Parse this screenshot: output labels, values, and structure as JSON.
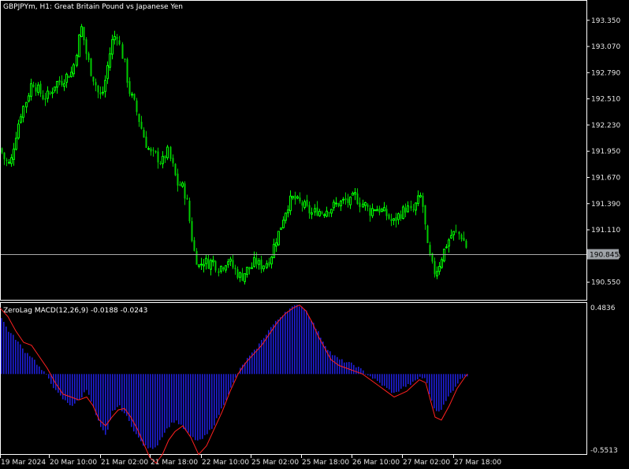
{
  "chart_data": [
    {
      "type": "candlestick",
      "title": "GBPJPYm, H1:  Great Britain Pound vs Japanese Yen",
      "current_price": "190.845",
      "ylim": [
        190.37,
        193.55
      ],
      "yticks": [
        "193.350",
        "193.070",
        "192.790",
        "192.510",
        "192.230",
        "191.950",
        "191.670",
        "191.390",
        "191.110",
        "190.830",
        "190.550"
      ],
      "xticks": [
        "19 Mar 2024",
        "20 Mar 10:00",
        "21 Mar 02:00",
        "21 Mar 18:00",
        "22 Mar 10:00",
        "25 Mar 02:00",
        "25 Mar 18:00",
        "26 Mar 10:00",
        "27 Mar 02:00",
        "27 Mar 18:00"
      ],
      "close_path": [
        [
          0,
          191.98
        ],
        [
          6,
          191.85
        ],
        [
          13,
          191.8
        ],
        [
          18,
          192.05
        ],
        [
          26,
          192.35
        ],
        [
          33,
          192.5
        ],
        [
          40,
          192.7
        ],
        [
          48,
          192.6
        ],
        [
          55,
          192.52
        ],
        [
          62,
          192.55
        ],
        [
          70,
          192.68
        ],
        [
          78,
          192.7
        ],
        [
          85,
          192.76
        ],
        [
          92,
          192.8
        ],
        [
          98,
          193.1
        ],
        [
          103,
          193.28
        ],
        [
          108,
          193.02
        ],
        [
          115,
          192.8
        ],
        [
          121,
          192.66
        ],
        [
          126,
          192.52
        ],
        [
          131,
          192.6
        ],
        [
          137,
          192.9
        ],
        [
          142,
          193.12
        ],
        [
          148,
          193.22
        ],
        [
          152,
          193.05
        ],
        [
          157,
          192.9
        ],
        [
          163,
          192.6
        ],
        [
          170,
          192.45
        ],
        [
          177,
          192.25
        ],
        [
          184,
          192.05
        ],
        [
          191,
          191.92
        ],
        [
          198,
          191.9
        ],
        [
          205,
          191.82
        ],
        [
          212,
          191.95
        ],
        [
          218,
          191.8
        ],
        [
          224,
          191.6
        ],
        [
          230,
          191.58
        ],
        [
          236,
          191.45
        ],
        [
          240,
          191.2
        ],
        [
          245,
          190.9
        ],
        [
          252,
          190.72
        ],
        [
          258,
          190.78
        ],
        [
          264,
          190.75
        ],
        [
          270,
          190.78
        ],
        [
          276,
          190.7
        ],
        [
          282,
          190.73
        ],
        [
          288,
          190.8
        ],
        [
          294,
          190.72
        ],
        [
          300,
          190.65
        ],
        [
          306,
          190.6
        ],
        [
          312,
          190.68
        ],
        [
          318,
          190.7
        ],
        [
          324,
          190.78
        ],
        [
          330,
          190.72
        ],
        [
          336,
          190.75
        ],
        [
          342,
          190.8
        ],
        [
          348,
          190.98
        ],
        [
          354,
          191.1
        ],
        [
          360,
          191.28
        ],
        [
          366,
          191.4
        ],
        [
          372,
          191.45
        ],
        [
          378,
          191.4
        ],
        [
          384,
          191.38
        ],
        [
          390,
          191.32
        ],
        [
          396,
          191.28
        ],
        [
          402,
          191.32
        ],
        [
          408,
          191.3
        ],
        [
          414,
          191.33
        ],
        [
          420,
          191.35
        ],
        [
          426,
          191.38
        ],
        [
          432,
          191.4
        ],
        [
          438,
          191.42
        ],
        [
          444,
          191.4
        ],
        [
          450,
          191.48
        ],
        [
          456,
          191.4
        ],
        [
          462,
          191.38
        ],
        [
          468,
          191.3
        ],
        [
          474,
          191.35
        ],
        [
          480,
          191.33
        ],
        [
          486,
          191.3
        ],
        [
          492,
          191.25
        ],
        [
          498,
          191.18
        ],
        [
          504,
          191.25
        ],
        [
          510,
          191.3
        ],
        [
          516,
          191.35
        ],
        [
          522,
          191.28
        ],
        [
          528,
          191.4
        ],
        [
          534,
          191.48
        ],
        [
          538,
          191.2
        ],
        [
          542,
          190.9
        ],
        [
          546,
          190.78
        ],
        [
          550,
          190.65
        ],
        [
          555,
          190.7
        ],
        [
          560,
          190.82
        ],
        [
          566,
          190.95
        ],
        [
          572,
          191.05
        ],
        [
          578,
          191.08
        ],
        [
          584,
          191.05
        ],
        [
          590,
          190.95
        ],
        [
          593,
          190.85
        ]
      ]
    },
    {
      "type": "bar+line",
      "title": "ZeroLag MACD(12,26,9) -0.0188 -0.0243",
      "ylim": [
        -0.5513,
        0.4836
      ],
      "ytick_labels": [
        "0.4836",
        "-0.5513"
      ],
      "histogram_color": "#1f1fd6",
      "signal_color": "#ff2020",
      "histogram_path": [
        [
          0,
          0.4
        ],
        [
          10,
          0.3
        ],
        [
          20,
          0.24
        ],
        [
          30,
          0.16
        ],
        [
          40,
          0.12
        ],
        [
          50,
          0.04
        ],
        [
          60,
          -0.02
        ],
        [
          70,
          -0.12
        ],
        [
          80,
          -0.18
        ],
        [
          90,
          -0.22
        ],
        [
          100,
          -0.18
        ],
        [
          110,
          -0.1
        ],
        [
          118,
          -0.24
        ],
        [
          126,
          -0.36
        ],
        [
          134,
          -0.44
        ],
        [
          142,
          -0.26
        ],
        [
          150,
          -0.22
        ],
        [
          158,
          -0.28
        ],
        [
          166,
          -0.36
        ],
        [
          174,
          -0.44
        ],
        [
          182,
          -0.5
        ],
        [
          190,
          -0.52
        ],
        [
          198,
          -0.5
        ],
        [
          206,
          -0.42
        ],
        [
          214,
          -0.36
        ],
        [
          222,
          -0.32
        ],
        [
          232,
          -0.38
        ],
        [
          242,
          -0.44
        ],
        [
          252,
          -0.47
        ],
        [
          262,
          -0.42
        ],
        [
          272,
          -0.34
        ],
        [
          282,
          -0.22
        ],
        [
          292,
          -0.1
        ],
        [
          302,
          0.02
        ],
        [
          312,
          0.1
        ],
        [
          322,
          0.16
        ],
        [
          332,
          0.24
        ],
        [
          342,
          0.32
        ],
        [
          352,
          0.38
        ],
        [
          362,
          0.44
        ],
        [
          372,
          0.47
        ],
        [
          380,
          0.48
        ],
        [
          388,
          0.44
        ],
        [
          396,
          0.36
        ],
        [
          404,
          0.28
        ],
        [
          412,
          0.2
        ],
        [
          420,
          0.14
        ],
        [
          430,
          0.1
        ],
        [
          440,
          0.08
        ],
        [
          450,
          0.06
        ],
        [
          460,
          0.02
        ],
        [
          470,
          -0.02
        ],
        [
          480,
          -0.06
        ],
        [
          490,
          -0.1
        ],
        [
          500,
          -0.14
        ],
        [
          508,
          -0.1
        ],
        [
          516,
          -0.08
        ],
        [
          524,
          -0.06
        ],
        [
          532,
          -0.02
        ],
        [
          540,
          -0.04
        ],
        [
          546,
          -0.18
        ],
        [
          552,
          -0.26
        ],
        [
          560,
          -0.24
        ],
        [
          570,
          -0.14
        ],
        [
          580,
          -0.06
        ],
        [
          590,
          0.0
        ],
        [
          593,
          -0.02
        ]
      ],
      "signal_path": [
        [
          0,
          0.46
        ],
        [
          10,
          0.4
        ],
        [
          20,
          0.3
        ],
        [
          30,
          0.22
        ],
        [
          40,
          0.2
        ],
        [
          50,
          0.12
        ],
        [
          60,
          0.04
        ],
        [
          70,
          -0.06
        ],
        [
          80,
          -0.14
        ],
        [
          90,
          -0.16
        ],
        [
          100,
          -0.18
        ],
        [
          110,
          -0.16
        ],
        [
          118,
          -0.22
        ],
        [
          126,
          -0.32
        ],
        [
          134,
          -0.36
        ],
        [
          142,
          -0.3
        ],
        [
          150,
          -0.25
        ],
        [
          158,
          -0.24
        ],
        [
          166,
          -0.3
        ],
        [
          174,
          -0.38
        ],
        [
          182,
          -0.48
        ],
        [
          190,
          -0.58
        ],
        [
          198,
          -0.62
        ],
        [
          206,
          -0.56
        ],
        [
          214,
          -0.46
        ],
        [
          222,
          -0.4
        ],
        [
          232,
          -0.36
        ],
        [
          242,
          -0.44
        ],
        [
          252,
          -0.56
        ],
        [
          262,
          -0.5
        ],
        [
          272,
          -0.38
        ],
        [
          282,
          -0.26
        ],
        [
          292,
          -0.12
        ],
        [
          302,
          0.0
        ],
        [
          312,
          0.08
        ],
        [
          322,
          0.14
        ],
        [
          332,
          0.2
        ],
        [
          342,
          0.28
        ],
        [
          352,
          0.36
        ],
        [
          362,
          0.42
        ],
        [
          372,
          0.46
        ],
        [
          380,
          0.48
        ],
        [
          388,
          0.44
        ],
        [
          396,
          0.36
        ],
        [
          404,
          0.26
        ],
        [
          412,
          0.18
        ],
        [
          420,
          0.1
        ],
        [
          430,
          0.06
        ],
        [
          440,
          0.04
        ],
        [
          450,
          0.02
        ],
        [
          460,
          0.0
        ],
        [
          470,
          -0.04
        ],
        [
          480,
          -0.08
        ],
        [
          490,
          -0.12
        ],
        [
          500,
          -0.16
        ],
        [
          508,
          -0.14
        ],
        [
          516,
          -0.12
        ],
        [
          524,
          -0.08
        ],
        [
          532,
          -0.04
        ],
        [
          540,
          -0.06
        ],
        [
          546,
          -0.18
        ],
        [
          552,
          -0.3
        ],
        [
          560,
          -0.32
        ],
        [
          570,
          -0.22
        ],
        [
          580,
          -0.1
        ],
        [
          590,
          -0.02
        ],
        [
          593,
          0.0
        ]
      ]
    }
  ],
  "colors": {
    "background": "#000000",
    "frame": "#ffffff",
    "bull_candle": "#00ff00",
    "bear_candle": "#00cc00",
    "price_line": "#a9a9a9",
    "price_tag_bg": "#9fa3a8",
    "text": "#e6e6e6"
  }
}
